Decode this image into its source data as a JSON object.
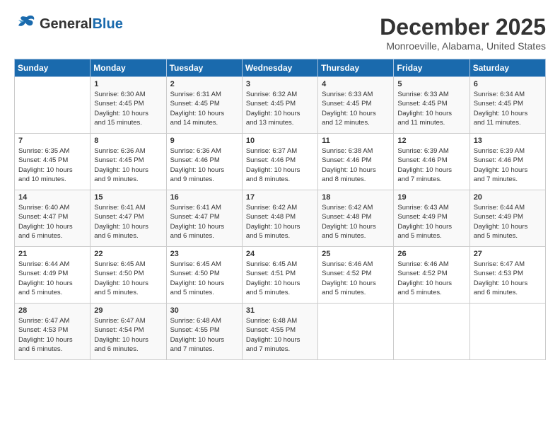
{
  "logo": {
    "general": "General",
    "blue": "Blue"
  },
  "title": "December 2025",
  "location": "Monroeville, Alabama, United States",
  "days_header": [
    "Sunday",
    "Monday",
    "Tuesday",
    "Wednesday",
    "Thursday",
    "Friday",
    "Saturday"
  ],
  "weeks": [
    [
      {
        "day": "",
        "info": ""
      },
      {
        "day": "1",
        "info": "Sunrise: 6:30 AM\nSunset: 4:45 PM\nDaylight: 10 hours\nand 15 minutes."
      },
      {
        "day": "2",
        "info": "Sunrise: 6:31 AM\nSunset: 4:45 PM\nDaylight: 10 hours\nand 14 minutes."
      },
      {
        "day": "3",
        "info": "Sunrise: 6:32 AM\nSunset: 4:45 PM\nDaylight: 10 hours\nand 13 minutes."
      },
      {
        "day": "4",
        "info": "Sunrise: 6:33 AM\nSunset: 4:45 PM\nDaylight: 10 hours\nand 12 minutes."
      },
      {
        "day": "5",
        "info": "Sunrise: 6:33 AM\nSunset: 4:45 PM\nDaylight: 10 hours\nand 11 minutes."
      },
      {
        "day": "6",
        "info": "Sunrise: 6:34 AM\nSunset: 4:45 PM\nDaylight: 10 hours\nand 11 minutes."
      }
    ],
    [
      {
        "day": "7",
        "info": "Sunrise: 6:35 AM\nSunset: 4:45 PM\nDaylight: 10 hours\nand 10 minutes."
      },
      {
        "day": "8",
        "info": "Sunrise: 6:36 AM\nSunset: 4:45 PM\nDaylight: 10 hours\nand 9 minutes."
      },
      {
        "day": "9",
        "info": "Sunrise: 6:36 AM\nSunset: 4:46 PM\nDaylight: 10 hours\nand 9 minutes."
      },
      {
        "day": "10",
        "info": "Sunrise: 6:37 AM\nSunset: 4:46 PM\nDaylight: 10 hours\nand 8 minutes."
      },
      {
        "day": "11",
        "info": "Sunrise: 6:38 AM\nSunset: 4:46 PM\nDaylight: 10 hours\nand 8 minutes."
      },
      {
        "day": "12",
        "info": "Sunrise: 6:39 AM\nSunset: 4:46 PM\nDaylight: 10 hours\nand 7 minutes."
      },
      {
        "day": "13",
        "info": "Sunrise: 6:39 AM\nSunset: 4:46 PM\nDaylight: 10 hours\nand 7 minutes."
      }
    ],
    [
      {
        "day": "14",
        "info": "Sunrise: 6:40 AM\nSunset: 4:47 PM\nDaylight: 10 hours\nand 6 minutes."
      },
      {
        "day": "15",
        "info": "Sunrise: 6:41 AM\nSunset: 4:47 PM\nDaylight: 10 hours\nand 6 minutes."
      },
      {
        "day": "16",
        "info": "Sunrise: 6:41 AM\nSunset: 4:47 PM\nDaylight: 10 hours\nand 6 minutes."
      },
      {
        "day": "17",
        "info": "Sunrise: 6:42 AM\nSunset: 4:48 PM\nDaylight: 10 hours\nand 5 minutes."
      },
      {
        "day": "18",
        "info": "Sunrise: 6:42 AM\nSunset: 4:48 PM\nDaylight: 10 hours\nand 5 minutes."
      },
      {
        "day": "19",
        "info": "Sunrise: 6:43 AM\nSunset: 4:49 PM\nDaylight: 10 hours\nand 5 minutes."
      },
      {
        "day": "20",
        "info": "Sunrise: 6:44 AM\nSunset: 4:49 PM\nDaylight: 10 hours\nand 5 minutes."
      }
    ],
    [
      {
        "day": "21",
        "info": "Sunrise: 6:44 AM\nSunset: 4:49 PM\nDaylight: 10 hours\nand 5 minutes."
      },
      {
        "day": "22",
        "info": "Sunrise: 6:45 AM\nSunset: 4:50 PM\nDaylight: 10 hours\nand 5 minutes."
      },
      {
        "day": "23",
        "info": "Sunrise: 6:45 AM\nSunset: 4:50 PM\nDaylight: 10 hours\nand 5 minutes."
      },
      {
        "day": "24",
        "info": "Sunrise: 6:45 AM\nSunset: 4:51 PM\nDaylight: 10 hours\nand 5 minutes."
      },
      {
        "day": "25",
        "info": "Sunrise: 6:46 AM\nSunset: 4:52 PM\nDaylight: 10 hours\nand 5 minutes."
      },
      {
        "day": "26",
        "info": "Sunrise: 6:46 AM\nSunset: 4:52 PM\nDaylight: 10 hours\nand 5 minutes."
      },
      {
        "day": "27",
        "info": "Sunrise: 6:47 AM\nSunset: 4:53 PM\nDaylight: 10 hours\nand 6 minutes."
      }
    ],
    [
      {
        "day": "28",
        "info": "Sunrise: 6:47 AM\nSunset: 4:53 PM\nDaylight: 10 hours\nand 6 minutes."
      },
      {
        "day": "29",
        "info": "Sunrise: 6:47 AM\nSunset: 4:54 PM\nDaylight: 10 hours\nand 6 minutes."
      },
      {
        "day": "30",
        "info": "Sunrise: 6:48 AM\nSunset: 4:55 PM\nDaylight: 10 hours\nand 7 minutes."
      },
      {
        "day": "31",
        "info": "Sunrise: 6:48 AM\nSunset: 4:55 PM\nDaylight: 10 hours\nand 7 minutes."
      },
      {
        "day": "",
        "info": ""
      },
      {
        "day": "",
        "info": ""
      },
      {
        "day": "",
        "info": ""
      }
    ]
  ]
}
